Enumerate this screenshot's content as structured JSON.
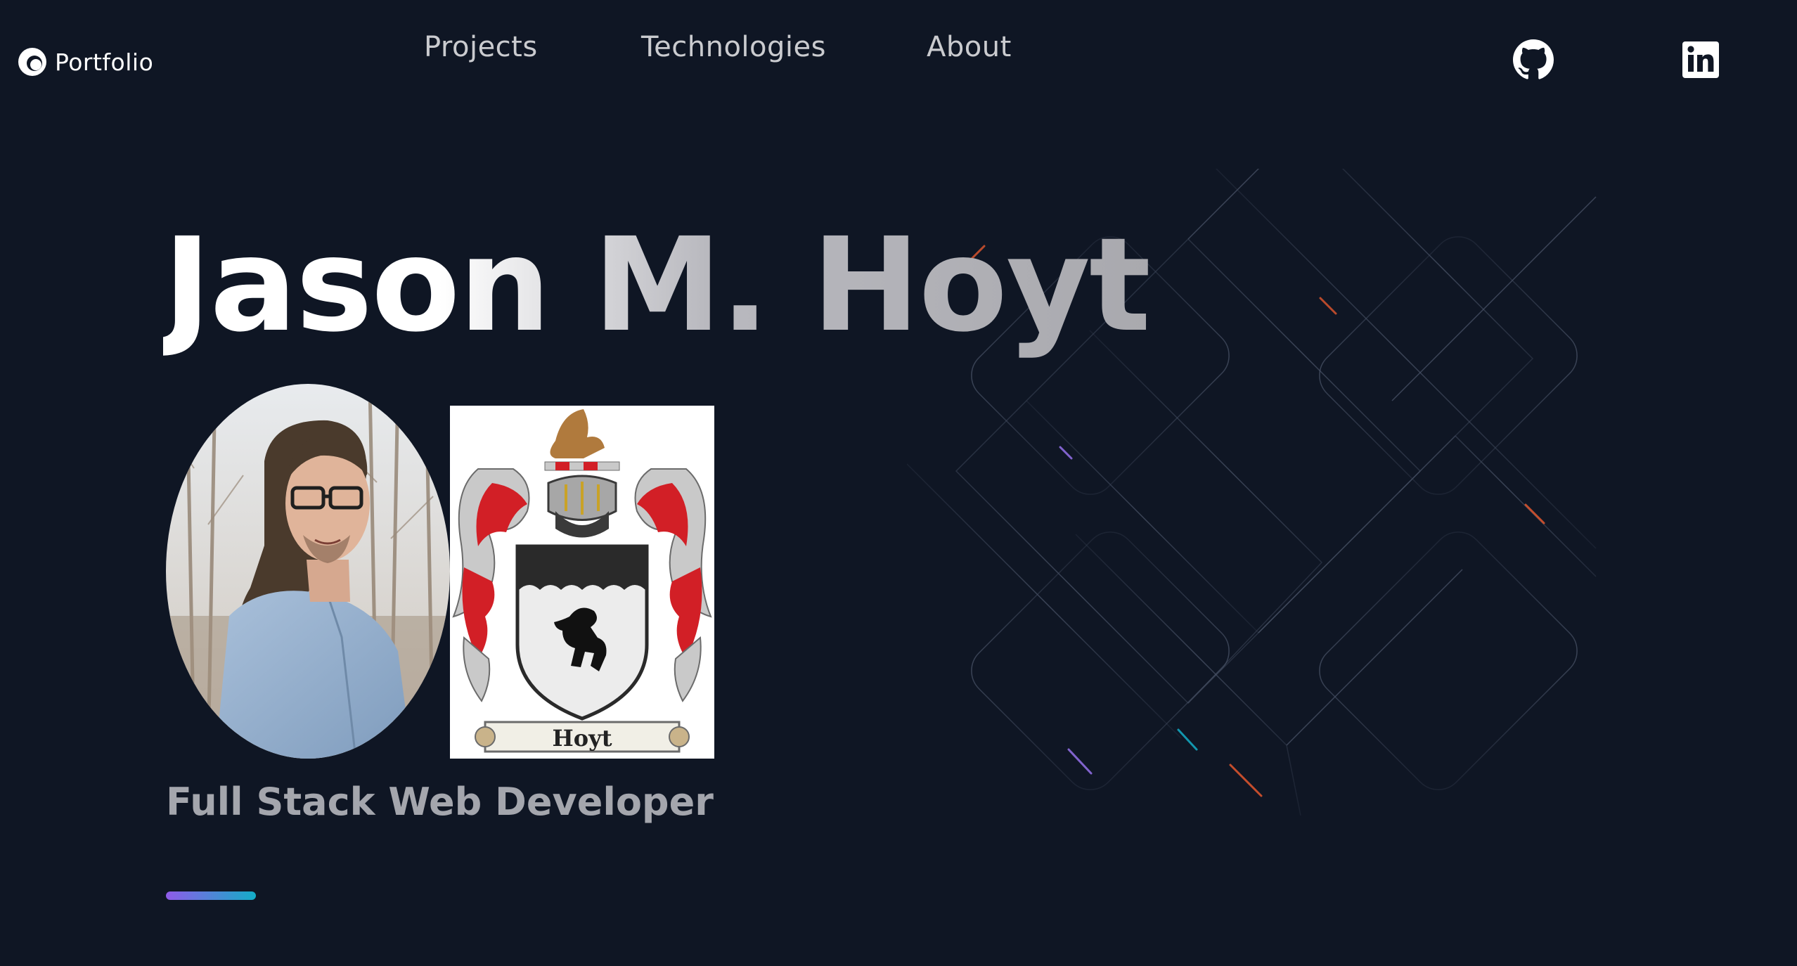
{
  "header": {
    "logo_text": "Portfolio",
    "nav": [
      {
        "label": "Projects"
      },
      {
        "label": "Technologies"
      },
      {
        "label": "About"
      }
    ],
    "social": [
      {
        "icon": "github-icon"
      },
      {
        "icon": "linkedin-icon"
      }
    ]
  },
  "hero": {
    "name": "Jason M. Hoyt",
    "subtitle": "Full Stack Web Developer",
    "crest_banner": "Hoyt"
  },
  "colors": {
    "background": "#0f1624",
    "subtitle": "#a4a6ad",
    "accent_gradient_start": "#8f5be8",
    "accent_gradient_end": "#13adc7"
  }
}
